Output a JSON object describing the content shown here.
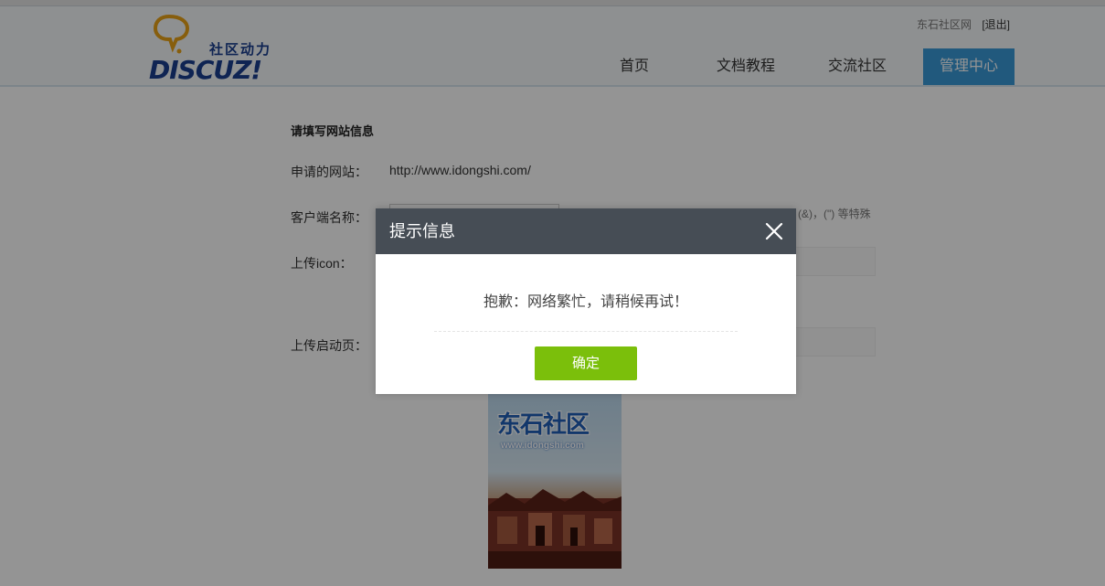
{
  "header": {
    "logo_tagline": "社区动力",
    "logo_word": "DISCUZ!",
    "user_site_link": "东石社区网",
    "logout_label": "[退出]",
    "nav": [
      {
        "label": "首页"
      },
      {
        "label": "文档教程"
      },
      {
        "label": "交流社区"
      },
      {
        "label": "管理中心"
      }
    ]
  },
  "form": {
    "section_title": "请填写网站信息",
    "site_label": "申请的网站：",
    "site_value": "http://www.idongshi.com/",
    "client_name_label": "客户端名称：",
    "client_name_value": "",
    "client_name_hint": "(&)，(\") 等特殊",
    "icon_label": "上传icon：",
    "splash_label": "上传启动页："
  },
  "splash_preview": {
    "logo_text": "东石社区",
    "url_text": "www.idongshi.com"
  },
  "dialog": {
    "title": "提示信息",
    "message": "抱歉：网络繁忙，请稍候再试！",
    "ok_label": "确定"
  },
  "colors": {
    "nav_active": "#3a99d8",
    "dialog_header": "#464d55",
    "ok_button": "#7bbf0b",
    "logo_blue": "#1a3f8f"
  }
}
